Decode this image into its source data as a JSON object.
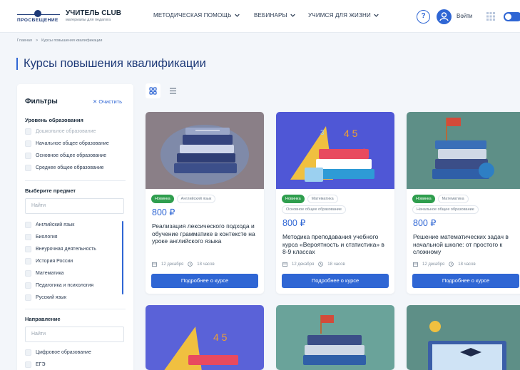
{
  "header": {
    "logo_text": "ПРОСВЕЩЕНИЕ",
    "brand_name": "УЧИТЕЛЬ CLUB",
    "brand_sub": "материалы для педагога",
    "nav": [
      {
        "label": "МЕТОДИЧЕСКАЯ ПОМОЩЬ"
      },
      {
        "label": "ВЕБИНАРЫ"
      },
      {
        "label": "УЧИМСЯ ДЛЯ ЖИЗНИ"
      }
    ],
    "help": "?",
    "login": "Войти",
    "accent": "#2f66d4"
  },
  "breadcrumb": {
    "home": "Главная",
    "sep": ">",
    "current": "Курсы повышения квалификации"
  },
  "page_title": "Курсы повышения квалификации",
  "filters": {
    "title": "Фильтры",
    "clear": "✕ Очистить",
    "level_title": "Уровень образования",
    "levels": [
      {
        "label": "Дошкольное образование",
        "disabled": true
      },
      {
        "label": "Начальное общее образование"
      },
      {
        "label": "Основное общее образование"
      },
      {
        "label": "Среднее общее образование"
      }
    ],
    "subject_title": "Выберите предмет",
    "subject_placeholder": "Найти",
    "subjects": [
      "Английский язык",
      "Биология",
      "Внеурочная деятельность",
      "История России",
      "Математика",
      "Педагогика и психология",
      "Русский язык"
    ],
    "direction_title": "Направление",
    "direction_placeholder": "Найти",
    "directions": [
      "Цифровое образование",
      "ЕГЭ"
    ]
  },
  "cards": [
    {
      "badge": "Новинка",
      "subject": "Английский язык",
      "level": "",
      "price": "800 ₽",
      "title": "Реализация лексического подхода и обучение грамматике в контексте на уроке английского языка",
      "date": "12 декабря",
      "hours": "18 часов",
      "button": "Подробнее о курсе"
    },
    {
      "badge": "Новинка",
      "subject": "Математика",
      "level": "Основное общее образование",
      "price": "800 ₽",
      "title": "Методика преподавания учебного курса «Вероятность и статистика» в 8-9 классах",
      "date": "12 декабря",
      "hours": "18 часов",
      "button": "Подробнее о курсе"
    },
    {
      "badge": "Новинка",
      "subject": "Математика",
      "level": "Начальное общее образование",
      "price": "800 ₽",
      "title": "Решение математических задач в начальной школе: от простого к сложному",
      "date": "12 декабря",
      "hours": "18 часов",
      "button": "Подробнее о курсе"
    }
  ]
}
